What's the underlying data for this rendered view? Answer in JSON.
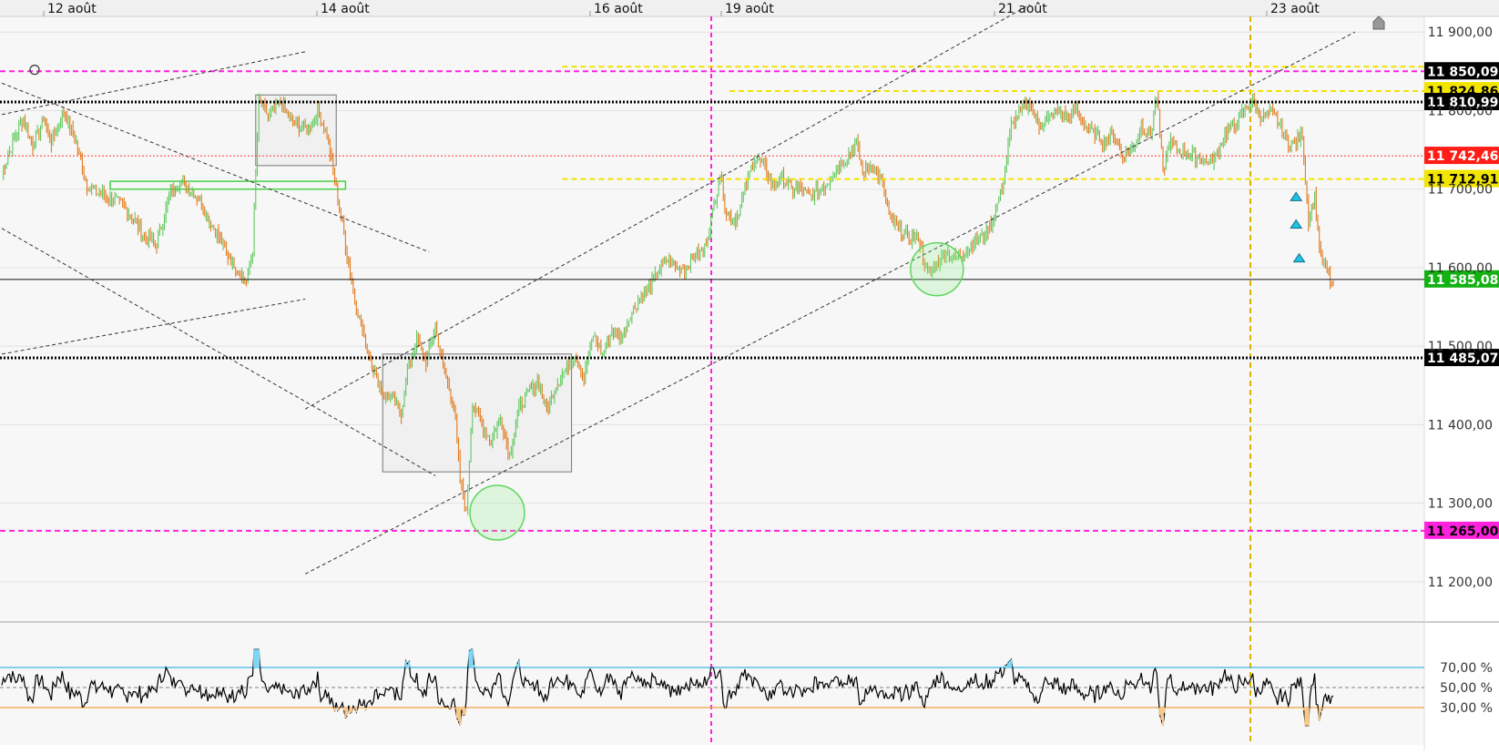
{
  "chart_data": {
    "type": "line",
    "instrument_subtype": "candlestick",
    "x_ticks": [
      "12 août",
      "14 août",
      "16 août",
      "19 août",
      "21 août",
      "23 août"
    ],
    "price_axis": {
      "ylim": [
        11150,
        11920
      ],
      "ticks": [
        {
          "value": 11900,
          "label": "11 900,00"
        },
        {
          "value": 11800,
          "label": "11 800,00"
        },
        {
          "value": 11700,
          "label": "11 700,00"
        },
        {
          "value": 11600,
          "label": "11 600,00"
        },
        {
          "value": 11500,
          "label": "11 500,00"
        },
        {
          "value": 11400,
          "label": "11 400,00"
        },
        {
          "value": 11300,
          "label": "11 300,00"
        },
        {
          "value": 11200,
          "label": "11 200,00"
        }
      ],
      "grid": true
    },
    "price_anchors": [
      [
        0,
        11720
      ],
      [
        8,
        11765
      ],
      [
        14,
        11790
      ],
      [
        20,
        11755
      ],
      [
        27,
        11790
      ],
      [
        32,
        11760
      ],
      [
        40,
        11800
      ],
      [
        48,
        11760
      ],
      [
        55,
        11705
      ],
      [
        62,
        11695
      ],
      [
        70,
        11690
      ],
      [
        78,
        11680
      ],
      [
        86,
        11660
      ],
      [
        92,
        11640
      ],
      [
        100,
        11630
      ],
      [
        108,
        11690
      ],
      [
        115,
        11710
      ],
      [
        120,
        11700
      ],
      [
        127,
        11690
      ],
      [
        134,
        11660
      ],
      [
        140,
        11640
      ],
      [
        146,
        11615
      ],
      [
        152,
        11600
      ],
      [
        158,
        11580
      ],
      [
        162,
        11625
      ],
      [
        166,
        11810
      ],
      [
        172,
        11795
      ],
      [
        180,
        11810
      ],
      [
        186,
        11790
      ],
      [
        192,
        11780
      ],
      [
        198,
        11775
      ],
      [
        204,
        11800
      ],
      [
        210,
        11770
      ],
      [
        216,
        11700
      ],
      [
        222,
        11630
      ],
      [
        228,
        11560
      ],
      [
        234,
        11510
      ],
      [
        240,
        11470
      ],
      [
        246,
        11440
      ],
      [
        252,
        11435
      ],
      [
        258,
        11415
      ],
      [
        262,
        11470
      ],
      [
        268,
        11510
      ],
      [
        274,
        11480
      ],
      [
        280,
        11525
      ],
      [
        286,
        11465
      ],
      [
        292,
        11425
      ],
      [
        296,
        11330
      ],
      [
        300,
        11285
      ],
      [
        304,
        11430
      ],
      [
        310,
        11400
      ],
      [
        316,
        11380
      ],
      [
        322,
        11410
      ],
      [
        328,
        11360
      ],
      [
        334,
        11420
      ],
      [
        340,
        11440
      ],
      [
        346,
        11455
      ],
      [
        352,
        11420
      ],
      [
        358,
        11450
      ],
      [
        364,
        11470
      ],
      [
        370,
        11490
      ],
      [
        376,
        11460
      ],
      [
        382,
        11515
      ],
      [
        388,
        11490
      ],
      [
        394,
        11520
      ],
      [
        400,
        11510
      ],
      [
        406,
        11540
      ],
      [
        412,
        11560
      ],
      [
        418,
        11575
      ],
      [
        424,
        11595
      ],
      [
        430,
        11610
      ],
      [
        436,
        11600
      ],
      [
        442,
        11600
      ],
      [
        448,
        11615
      ],
      [
        454,
        11625
      ],
      [
        460,
        11680
      ],
      [
        464,
        11720
      ],
      [
        468,
        11670
      ],
      [
        474,
        11660
      ],
      [
        480,
        11700
      ],
      [
        486,
        11740
      ],
      [
        492,
        11730
      ],
      [
        498,
        11705
      ],
      [
        504,
        11715
      ],
      [
        510,
        11700
      ],
      [
        516,
        11700
      ],
      [
        522,
        11690
      ],
      [
        528,
        11700
      ],
      [
        534,
        11710
      ],
      [
        540,
        11730
      ],
      [
        546,
        11740
      ],
      [
        552,
        11760
      ],
      [
        556,
        11720
      ],
      [
        562,
        11730
      ],
      [
        568,
        11710
      ],
      [
        574,
        11660
      ],
      [
        580,
        11650
      ],
      [
        586,
        11635
      ],
      [
        592,
        11640
      ],
      [
        598,
        11590
      ],
      [
        604,
        11605
      ],
      [
        610,
        11620
      ],
      [
        616,
        11610
      ],
      [
        622,
        11620
      ],
      [
        628,
        11635
      ],
      [
        634,
        11640
      ],
      [
        640,
        11660
      ],
      [
        646,
        11700
      ],
      [
        652,
        11780
      ],
      [
        658,
        11800
      ],
      [
        664,
        11810
      ],
      [
        670,
        11780
      ],
      [
        676,
        11790
      ],
      [
        682,
        11800
      ],
      [
        688,
        11790
      ],
      [
        694,
        11800
      ],
      [
        700,
        11780
      ],
      [
        706,
        11770
      ],
      [
        712,
        11760
      ],
      [
        718,
        11770
      ],
      [
        724,
        11740
      ],
      [
        730,
        11750
      ],
      [
        736,
        11780
      ],
      [
        742,
        11770
      ],
      [
        746,
        11820
      ],
      [
        750,
        11720
      ],
      [
        754,
        11760
      ],
      [
        760,
        11750
      ],
      [
        766,
        11745
      ],
      [
        772,
        11740
      ],
      [
        778,
        11735
      ],
      [
        784,
        11740
      ],
      [
        790,
        11770
      ],
      [
        796,
        11780
      ],
      [
        802,
        11800
      ],
      [
        808,
        11810
      ],
      [
        814,
        11790
      ],
      [
        820,
        11800
      ],
      [
        826,
        11780
      ],
      [
        832,
        11755
      ],
      [
        836,
        11760
      ],
      [
        840,
        11770
      ],
      [
        844,
        11660
      ],
      [
        848,
        11690
      ],
      [
        852,
        11610
      ],
      [
        856,
        11595
      ],
      [
        860,
        11570
      ]
    ],
    "horizontal_levels": [
      {
        "value": 11850.09,
        "label": "11 850,09",
        "color": "#ff22dd",
        "style": "dashed",
        "label_bg": "#000000",
        "label_fg": "#ffffff"
      },
      {
        "value": 11824.86,
        "label": "11 824,86",
        "color": "#f2e200",
        "style": "dashed",
        "label_bg": "#f2e600",
        "label_fg": "#000000"
      },
      {
        "value": 11810.99,
        "label": "11 810,99",
        "color": "#000000",
        "style": "dotted",
        "label_bg": "#000000",
        "label_fg": "#ffffff"
      },
      {
        "value": 11742.46,
        "label": "11 742,46",
        "color": "#ff3b30",
        "style": "dotted",
        "label_bg": "#ff1d16",
        "label_fg": "#ffffff"
      },
      {
        "value": 11712.91,
        "label": "11 712,91",
        "color": "#f2e200",
        "style": "dashed",
        "label_bg": "#f2e600",
        "label_fg": "#000000"
      },
      {
        "value": 11585.08,
        "label": "11 585,08",
        "color": "#111111",
        "style": "solid",
        "label_bg": "#12b212",
        "label_fg": "#ffffff"
      },
      {
        "value": 11485.07,
        "label": "11 485,07",
        "color": "#000000",
        "style": "dotted",
        "label_bg": "#000000",
        "label_fg": "#ffffff"
      },
      {
        "value": 11265.0,
        "label": "11 265,00",
        "color": "#ff22dd",
        "style": "dashed",
        "label_bg": "#ff22dd",
        "label_fg": "#000000"
      }
    ],
    "rsi": {
      "ylim": [
        0,
        100
      ],
      "levels": [
        {
          "value": 70,
          "label": "70,00 %",
          "color": "#39b7e6"
        },
        {
          "value": 50,
          "label": "50,00 %",
          "color": "#999999"
        },
        {
          "value": 30,
          "label": "30,00 %",
          "color": "#f0a040"
        }
      ],
      "overbought_fill": "#7fd6f2",
      "oversold_fill": "#f7c98a"
    },
    "colors": {
      "up_candle": "#5ec85e",
      "down_candle": "#e07a1e",
      "trendline": "#333333",
      "highlight_circle": "#5fd65f",
      "box_fill": "#f0f0f0",
      "box_stroke": "#777777",
      "marker": "#20c2e6"
    },
    "legend": "none"
  }
}
